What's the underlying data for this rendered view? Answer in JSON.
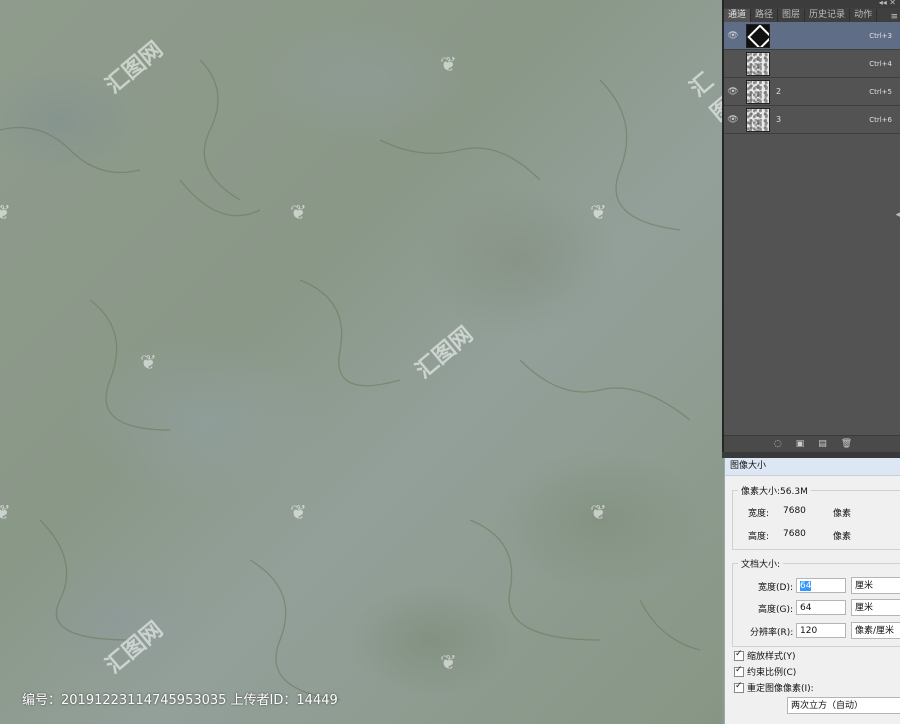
{
  "caption": "编号：20191223114745953035 上传者ID：14449",
  "watermark": "汇图网",
  "channels_panel": {
    "tabs": [
      "通道",
      "路径",
      "图层",
      "历史记录",
      "动作"
    ],
    "active_tab": "通道",
    "menu_icon": "≡",
    "channels": [
      {
        "name": "",
        "shortcut": "Ctrl+3",
        "thumb": "black",
        "selected": true
      },
      {
        "name": "",
        "shortcut": "Ctrl+4",
        "thumb": "speckle",
        "selected": false
      },
      {
        "name": "2",
        "shortcut": "Ctrl+5",
        "thumb": "speckle",
        "selected": false
      },
      {
        "name": "3",
        "shortcut": "Ctrl+6",
        "thumb": "speckle",
        "selected": false
      }
    ]
  },
  "dialog": {
    "title": "图像大小",
    "pixel_size": "像素大小:56.3M",
    "width_label": "宽度:",
    "width_value": "7680",
    "width_unit": "像素",
    "height_label": "高度:",
    "height_value": "7680",
    "height_unit": "像素",
    "doc_size": "文档大小:",
    "doc_width_label": "宽度(D):",
    "doc_width_value": "64",
    "doc_width_unit": "厘米",
    "doc_height_label": "高度(G):",
    "doc_height_value": "64",
    "doc_height_unit": "厘米",
    "res_label": "分辨率(R):",
    "res_value": "120",
    "res_unit": "像素/厘米",
    "scale_styles": "缩放样式(Y)",
    "constrain": "约束比例(C)",
    "resample": "重定图像像素(I):",
    "resample_method": "两次立方（自动）"
  }
}
